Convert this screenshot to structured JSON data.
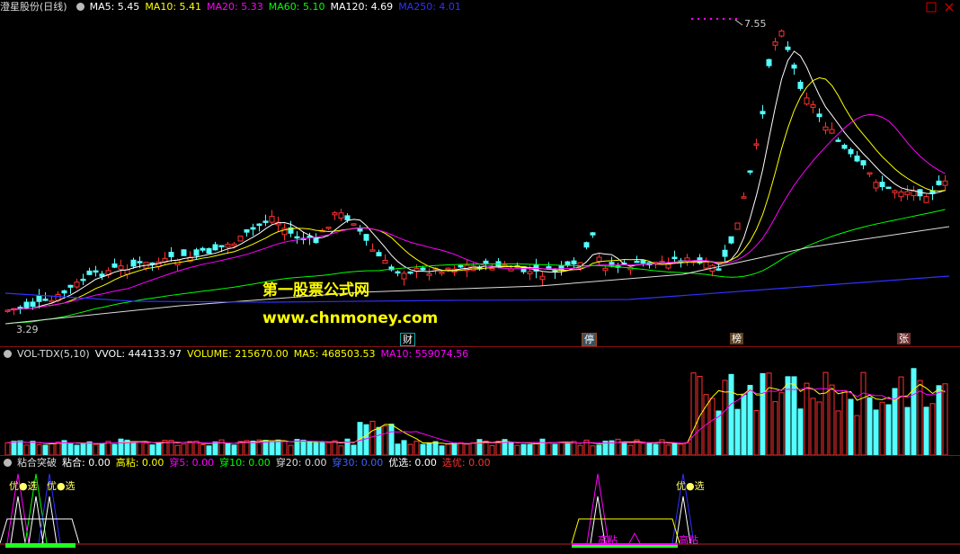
{
  "price_panel": {
    "stock_name": "澄星股份",
    "period": "(日线)",
    "ma_labels": [
      {
        "text": "MA5: 5.45",
        "color": "#ffffff"
      },
      {
        "text": "MA10: 5.41",
        "color": "#ffff00"
      },
      {
        "text": "MA20: 5.33",
        "color": "#ff00ff"
      },
      {
        "text": "MA60: 5.10",
        "color": "#00ff00"
      },
      {
        "text": "MA120: 4.69",
        "color": "#ffffff"
      },
      {
        "text": "MA250: 4.01",
        "color": "#3030ff"
      }
    ],
    "high_label": "7.55",
    "low_label": "3.29",
    "event_tags": [
      "财",
      "停",
      "榜",
      "张"
    ],
    "watermark_line1": "第一股票公式网",
    "watermark_line2": "www.chnmoney.com"
  },
  "volume_panel": {
    "indicator": "VOL-TDX(5,10)",
    "labels": [
      {
        "text": "VVOL: 444133.97",
        "color": "#ffffff"
      },
      {
        "text": "VOLUME: 215670.00",
        "color": "#ffff00"
      },
      {
        "text": "MA5: 468503.53",
        "color": "#ffff00"
      },
      {
        "text": "MA10: 559074.56",
        "color": "#ff00ff"
      }
    ]
  },
  "signal_panel": {
    "indicator": "粘合突破",
    "labels": [
      {
        "text": "粘合: 0.00",
        "color": "#ffffff"
      },
      {
        "text": "高粘: 0.00",
        "color": "#ffff00"
      },
      {
        "text": "穿5: 0.00",
        "color": "#ff00ff"
      },
      {
        "text": "穿10: 0.00",
        "color": "#00ff00"
      },
      {
        "text": "穿20: 0.00",
        "color": "#dddddd"
      },
      {
        "text": "穿30: 0.00",
        "color": "#4060ff"
      },
      {
        "text": "优选: 0.00",
        "color": "#ffffff"
      },
      {
        "text": "选优: 0.00",
        "color": "#ff3030"
      }
    ],
    "markers": [
      "优●选",
      "优●选",
      "优●选"
    ],
    "sub_labels": [
      "高粘",
      "高粘"
    ]
  }
}
